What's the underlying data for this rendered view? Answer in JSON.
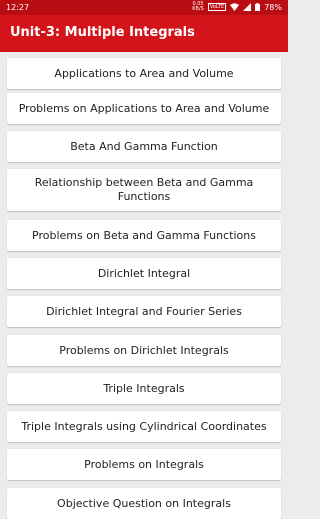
{
  "status_bar": {
    "time": "12:27",
    "network_speed_value": "0.05",
    "network_speed_unit": "KB/S",
    "volte": "VoLTE",
    "battery": "78%"
  },
  "app_bar": {
    "title": "Unit-3: Multiple Integrals",
    "color": "#d3151b"
  },
  "items": [
    {
      "label": "Applications to Area and Volume"
    },
    {
      "label": "Problems on Applications to Area and Volume"
    },
    {
      "label": "Beta And Gamma Function"
    },
    {
      "label": "Relationship between Beta and Gamma Functions"
    },
    {
      "label": "Problems on Beta and Gamma Functions"
    },
    {
      "label": "Dirichlet Integral"
    },
    {
      "label": "Dirichlet Integral and Fourier Series"
    },
    {
      "label": "Problems on Dirichlet Integrals"
    },
    {
      "label": "Triple Integrals"
    },
    {
      "label": "Triple Integrals using Cylindrical Coordinates"
    },
    {
      "label": "Problems on Integrals"
    },
    {
      "label": "Objective Question on Integrals"
    }
  ]
}
